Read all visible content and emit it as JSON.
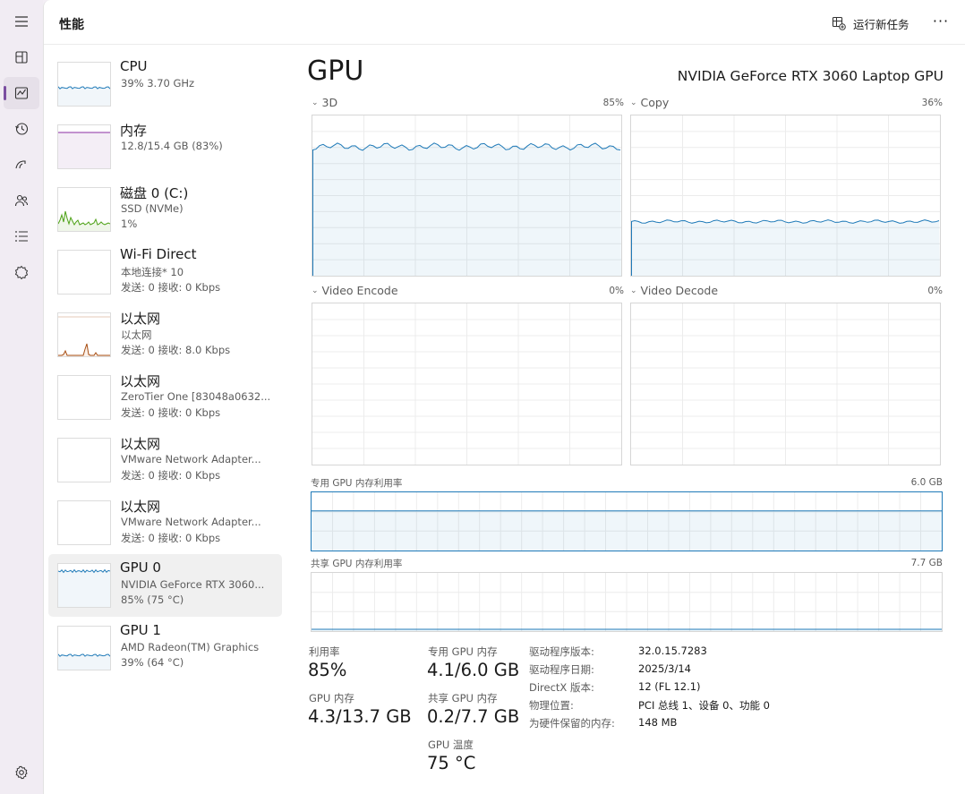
{
  "window": {
    "title": "性能"
  },
  "toolbar": {
    "run_task_label": "运行新任务",
    "more_label": "···"
  },
  "rail": {
    "items": [
      {
        "name": "hamburger-menu-icon"
      },
      {
        "name": "processes-icon"
      },
      {
        "name": "performance-icon",
        "active": true
      },
      {
        "name": "app-history-icon"
      },
      {
        "name": "startup-apps-icon"
      },
      {
        "name": "users-icon"
      },
      {
        "name": "details-icon"
      },
      {
        "name": "services-icon"
      },
      {
        "name": "settings-icon"
      }
    ]
  },
  "devices": [
    {
      "name": "CPU",
      "sub": "39% 3.70 GHz",
      "sub2": "",
      "color": "#1f7ab8"
    },
    {
      "name": "内存",
      "sub": "12.8/15.4 GB (83%)",
      "sub2": "",
      "color": "#8b2ea3"
    },
    {
      "name": "磁盘 0 (C:)",
      "sub": "SSD (NVMe)",
      "sub2": "1%",
      "color": "#4ea217"
    },
    {
      "name": "Wi-Fi Direct",
      "sub": "本地连接* 10",
      "sub2": "发送: 0 接收: 0 Kbps",
      "color": "#a74e13"
    },
    {
      "name": "以太网",
      "sub": "以太网",
      "sub2": "发送: 0 接收: 8.0 Kbps",
      "color": "#a74e13"
    },
    {
      "name": "以太网",
      "sub": "ZeroTier One [83048a0632...",
      "sub2": "发送: 0 接收: 0 Kbps",
      "color": "#a74e13"
    },
    {
      "name": "以太网",
      "sub": "VMware Network Adapter...",
      "sub2": "发送: 0 接收: 0 Kbps",
      "color": "#a74e13"
    },
    {
      "name": "以太网",
      "sub": "VMware Network Adapter...",
      "sub2": "发送: 0 接收: 0 Kbps",
      "color": "#a74e13"
    },
    {
      "name": "GPU 0",
      "sub": "NVIDIA GeForce RTX 3060...",
      "sub2": "85% (75 °C)",
      "color": "#1f7ab8"
    },
    {
      "name": "GPU 1",
      "sub": "AMD Radeon(TM) Graphics",
      "sub2": "39% (64 °C)",
      "color": "#1f7ab8"
    }
  ],
  "gpu": {
    "title": "GPU",
    "model": "NVIDIA GeForce RTX 3060 Laptop GPU",
    "engines": [
      {
        "label": "3D",
        "pct": "85%",
        "level": 0.85
      },
      {
        "label": "Copy",
        "pct": "36%",
        "level": 0.36
      },
      {
        "label": "Video Encode",
        "pct": "0%",
        "level": 0
      },
      {
        "label": "Video Decode",
        "pct": "0%",
        "level": 0
      }
    ],
    "dedicated_mem": {
      "label": "专用 GPU 内存利用率",
      "max": "6.0 GB",
      "level": 0.68
    },
    "shared_mem": {
      "label": "共享 GPU 内存利用率",
      "max": "7.7 GB",
      "level": 0.03
    },
    "stats": {
      "util_label": "利用率",
      "util_value": "85%",
      "gpumem_label": "GPU 内存",
      "gpumem_value": "4.3/13.7 GB",
      "ded_label": "专用 GPU 内存",
      "ded_value": "4.1/6.0 GB",
      "shared_label": "共享 GPU 内存",
      "shared_value": "0.2/7.7 GB",
      "temp_label": "GPU 温度",
      "temp_value": "75 °C"
    },
    "info": [
      {
        "label": "驱动程序版本:",
        "value": "32.0.15.7283"
      },
      {
        "label": "驱动程序日期:",
        "value": "2025/3/14"
      },
      {
        "label": "DirectX 版本:",
        "value": "12 (FL 12.1)"
      },
      {
        "label": "物理位置:",
        "value": "PCI 总线 1、设备 0、功能 0"
      },
      {
        "label": "为硬件保留的内存:",
        "value": "148 MB"
      }
    ]
  },
  "colors": {
    "accent": "#1f7ab8",
    "fill": "#f1f6fa",
    "grid": "#ececec"
  }
}
